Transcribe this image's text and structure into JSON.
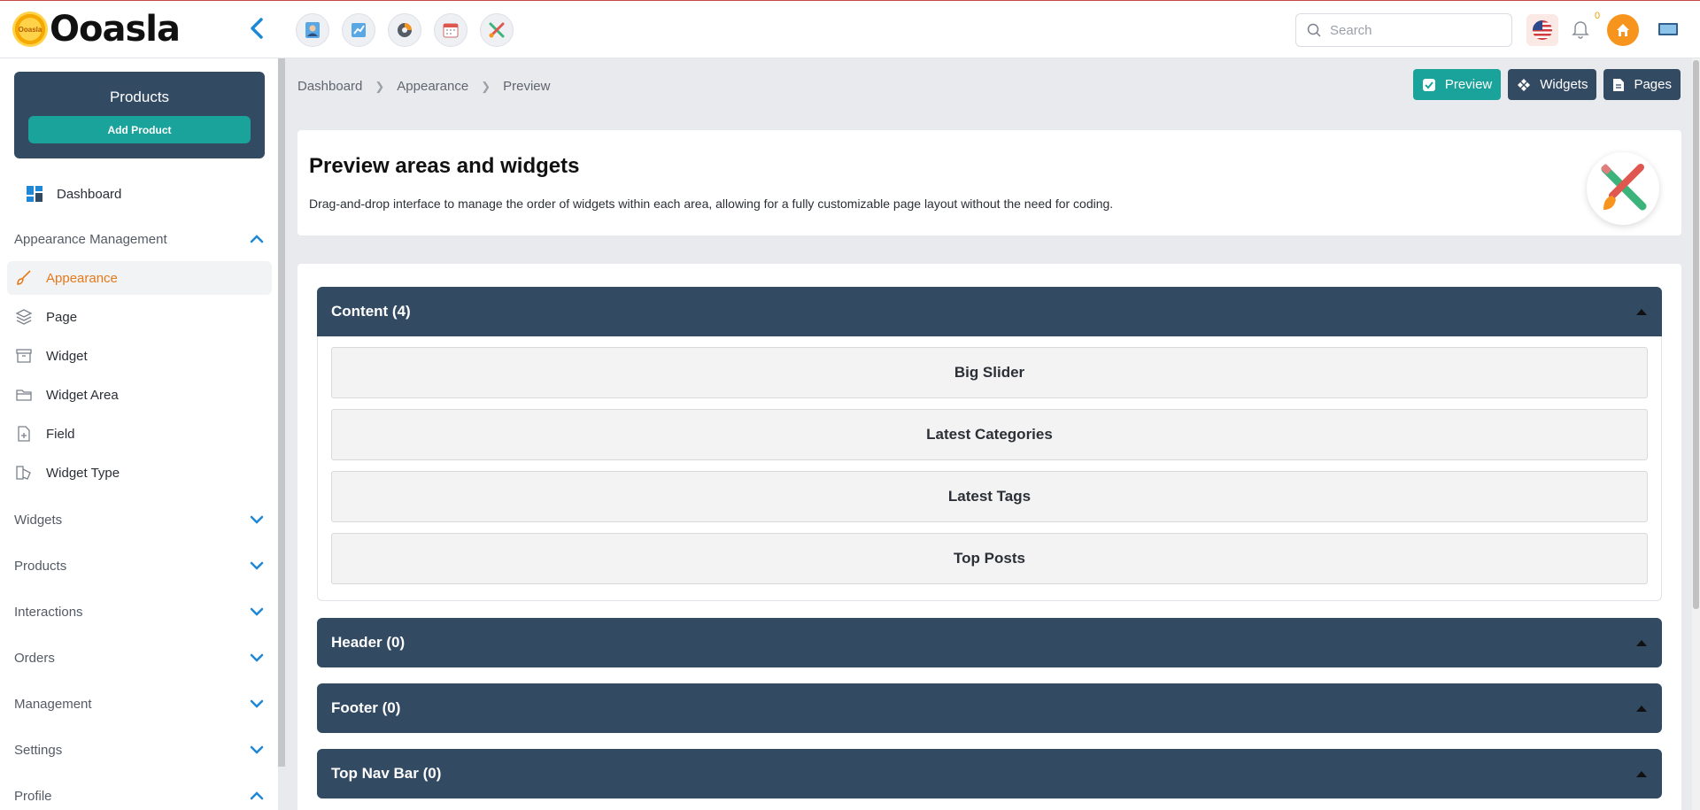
{
  "brand": {
    "name": "Ooasla",
    "badge": "Ooasla"
  },
  "topbar": {
    "search_placeholder": "Search",
    "notification_count": "0",
    "quick_icons": [
      "user-card-icon",
      "chart-icon",
      "pie-chart-icon",
      "calendar-icon",
      "tools-icon"
    ]
  },
  "sidebar": {
    "products_card": {
      "title": "Products",
      "add_label": "Add Product"
    },
    "dashboard": "Dashboard",
    "sections": {
      "appearance_management": "Appearance Management",
      "widgets": "Widgets",
      "products": "Products",
      "interactions": "Interactions",
      "orders": "Orders",
      "management": "Management",
      "settings": "Settings",
      "profile": "Profile"
    },
    "appearance_items": [
      {
        "label": "Appearance",
        "icon": "brush-icon",
        "active": true
      },
      {
        "label": "Page",
        "icon": "layers-icon"
      },
      {
        "label": "Widget",
        "icon": "archive-icon"
      },
      {
        "label": "Widget Area",
        "icon": "folder-icon"
      },
      {
        "label": "Field",
        "icon": "file-plus-icon"
      },
      {
        "label": "Widget Type",
        "icon": "shapes-icon"
      }
    ]
  },
  "breadcrumb": [
    "Dashboard",
    "Appearance",
    "Preview"
  ],
  "actions": {
    "preview": "Preview",
    "widgets": "Widgets",
    "pages": "Pages"
  },
  "intro": {
    "title": "Preview areas and widgets",
    "description": "Drag-and-drop interface to manage the order of widgets within each area, allowing for a fully customizable page layout without the need for coding."
  },
  "areas": [
    {
      "title": "Content (4)",
      "widgets": [
        "Big Slider",
        "Latest Categories",
        "Latest Tags",
        "Top Posts"
      ]
    },
    {
      "title": "Header (0)",
      "widgets": []
    },
    {
      "title": "Footer (0)",
      "widgets": []
    },
    {
      "title": "Top Nav Bar (0)",
      "widgets": []
    }
  ],
  "colors": {
    "primary_dark": "#334a63",
    "teal": "#1aa39a",
    "accent_orange": "#e47a1c",
    "link_blue": "#1e88d6"
  }
}
